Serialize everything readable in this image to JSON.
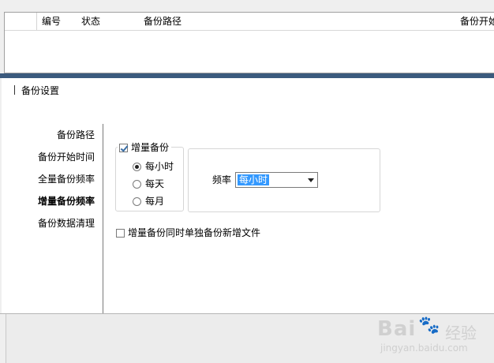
{
  "table": {
    "columns": [
      "",
      "编号",
      "状态",
      "备份路径",
      "备份开始"
    ]
  },
  "panel": {
    "title": "备份设置",
    "nav": [
      {
        "label": "备份路径",
        "active": false
      },
      {
        "label": "备份开始时间",
        "active": false
      },
      {
        "label": "全量备份频率",
        "active": false
      },
      {
        "label": "增量备份频率",
        "active": true
      },
      {
        "label": "备份数据清理",
        "active": false
      }
    ],
    "incremental": {
      "label": "增量备份",
      "checked": true,
      "options": [
        "每小时",
        "每天",
        "每月"
      ],
      "selected": 0
    },
    "frequency": {
      "label": "频率",
      "value": "每小时"
    },
    "extra_option": {
      "label": "增量备份同时单独备份新增文件",
      "checked": false
    }
  },
  "watermark": {
    "logo": "Bai",
    "paw": "🐾",
    "text": "经验",
    "url": "jingyan.baidu.com"
  }
}
